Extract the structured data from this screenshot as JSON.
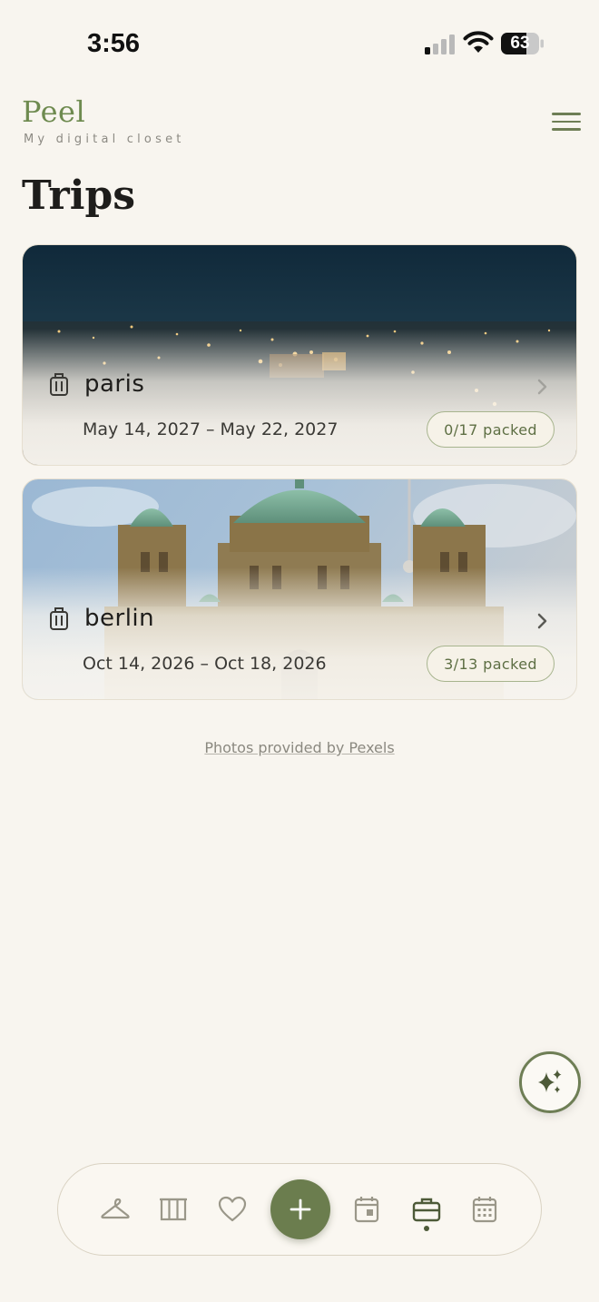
{
  "status_bar": {
    "time": "3:56",
    "battery": "63"
  },
  "header": {
    "app_name": "Peel",
    "tagline": "My digital closet"
  },
  "page": {
    "title": "Trips"
  },
  "trips": [
    {
      "name": "paris",
      "dates": "May 14, 2027 – May 22, 2027",
      "packed": "0/17 packed"
    },
    {
      "name": "berlin",
      "dates": "Oct 14, 2026 – Oct 18, 2026",
      "packed": "3/13 packed"
    }
  ],
  "footer": {
    "credits": "Photos provided by Pexels"
  },
  "bottom_nav": {
    "items": [
      "hanger-icon",
      "wardrobe-icon",
      "heart-icon",
      "add-icon",
      "calendar-day-icon",
      "suitcase-icon",
      "calendar-icon"
    ],
    "active": "suitcase-icon"
  },
  "colors": {
    "accent": "#6b7d4e",
    "background": "#f8f5ef",
    "text": "#1e1d1b"
  }
}
